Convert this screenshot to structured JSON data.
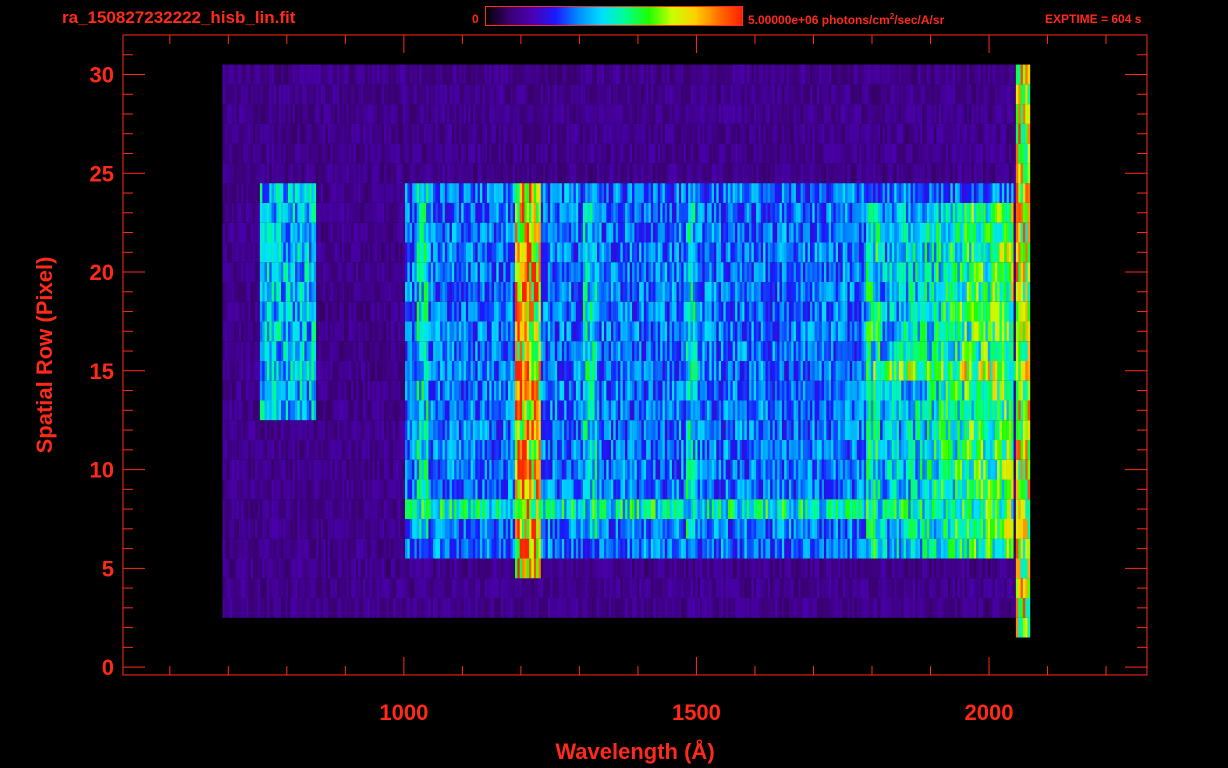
{
  "header": {
    "filename": "ra_150827232222_hisb_lin.fit",
    "colorbar_min": "0",
    "colorbar_max_prefix": "5.00000e+06 photons/cm",
    "colorbar_max_sup": "2",
    "colorbar_max_suffix": "/sec/A/sr",
    "exptime": "EXPTIME = 604 s"
  },
  "colors": {
    "axis": "#ff2a1a",
    "background": "#000000",
    "colormap": [
      "#000000",
      "#3a0070",
      "#4b00b4",
      "#1a1aff",
      "#0090ff",
      "#00e0ff",
      "#00ff90",
      "#20ff00",
      "#c8ff00",
      "#ffd000",
      "#ff7000",
      "#ff2000"
    ]
  },
  "chart_data": {
    "type": "heatmap",
    "title": "ra_150827232222_hisb_lin.fit",
    "xlabel": "Wavelength (Å)",
    "ylabel": "Spatial Row (Pixel)",
    "xlim": [
      520,
      2270
    ],
    "ylim": [
      -0.4,
      32
    ],
    "x_ticks": [
      1000,
      1500,
      2000
    ],
    "y_ticks": [
      0,
      5,
      10,
      15,
      20,
      25,
      30
    ],
    "colorbar": {
      "min": 0,
      "max": 5000000,
      "units": "photons/cm^2/sec/A/sr",
      "colormap": "rainbow"
    },
    "data_extent": {
      "x": [
        690,
        2070
      ],
      "y": [
        0,
        30
      ]
    },
    "features": [
      {
        "x": 1200,
        "y_range": [
          5,
          24
        ],
        "level": 0.95
      },
      {
        "x": 1220,
        "y_range": [
          5,
          24
        ],
        "level": 0.9
      },
      {
        "x": 2055,
        "y_range": [
          2,
          30
        ],
        "level": 0.85
      },
      {
        "x": 1800,
        "y_range": [
          6,
          23
        ],
        "level": 0.6
      },
      {
        "x": 1030,
        "y_range": [
          7,
          24
        ],
        "level": 0.55
      },
      {
        "x": 1315,
        "y_range": [
          7,
          23
        ],
        "level": 0.55
      },
      {
        "x": 1490,
        "y_range": [
          7,
          23
        ],
        "level": 0.55
      }
    ],
    "row_bands": [
      {
        "y": 8,
        "x_range": [
          1000,
          2040
        ],
        "level": 0.6
      },
      {
        "y": 15,
        "x_range": [
          1800,
          2050
        ],
        "level": 0.8
      },
      {
        "y_range": [
          6,
          24
        ],
        "x_range": [
          1000,
          2040
        ],
        "level": 0.4
      },
      {
        "y_range": [
          3,
          30
        ],
        "x_range": [
          690,
          2070
        ],
        "level": 0.15
      }
    ]
  }
}
